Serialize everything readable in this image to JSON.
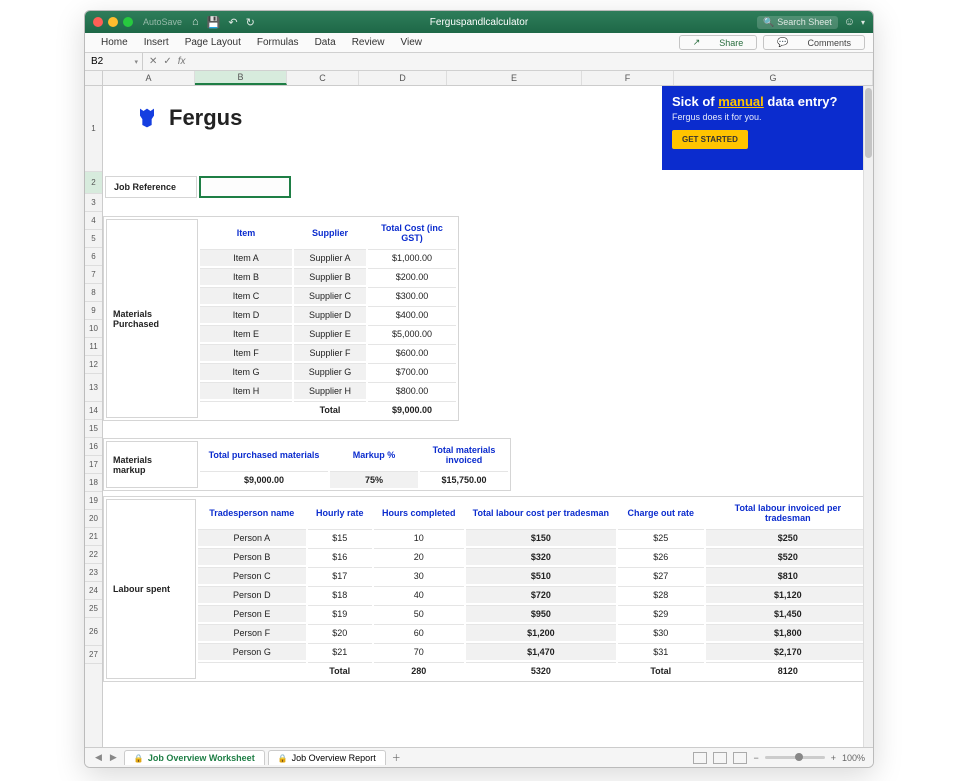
{
  "titlebar": {
    "autosave": "AutoSave",
    "title": "Ferguspandlcalculator",
    "search_placeholder": "Search Sheet"
  },
  "ribbon": {
    "tabs": [
      "Home",
      "Insert",
      "Page Layout",
      "Formulas",
      "Data",
      "Review",
      "View"
    ],
    "share": "Share",
    "comments": "Comments"
  },
  "formula": {
    "cell": "B2",
    "fx": "fx"
  },
  "columns": [
    "A",
    "B",
    "C",
    "D",
    "E",
    "F",
    "G"
  ],
  "logo": "Fergus",
  "banner": {
    "pre": "Sick of ",
    "mid": "manual",
    "post": " data entry?",
    "sub": "Fergus does it for you.",
    "cta": "GET STARTED"
  },
  "jobref": {
    "label": "Job Reference",
    "value": ""
  },
  "materials": {
    "section": "Materials Purchased",
    "headers": [
      "Item",
      "Supplier",
      "Total Cost (inc GST)"
    ],
    "rows": [
      [
        "Item A",
        "Supplier A",
        "$1,000.00"
      ],
      [
        "Item B",
        "Supplier B",
        "$200.00"
      ],
      [
        "Item C",
        "Supplier C",
        "$300.00"
      ],
      [
        "Item D",
        "Supplier D",
        "$400.00"
      ],
      [
        "Item E",
        "Supplier E",
        "$5,000.00"
      ],
      [
        "Item F",
        "Supplier F",
        "$600.00"
      ],
      [
        "Item G",
        "Supplier G",
        "$700.00"
      ],
      [
        "Item H",
        "Supplier H",
        "$800.00"
      ]
    ],
    "total_label": "Total",
    "total": "$9,000.00"
  },
  "markup": {
    "section": "Materials markup",
    "headers": [
      "Total purchased materials",
      "Markup %",
      "Total materials invoiced"
    ],
    "row": [
      "$9,000.00",
      "75%",
      "$15,750.00"
    ]
  },
  "labour": {
    "section": "Labour spent",
    "headers": [
      "Tradesperson name",
      "Hourly rate",
      "Hours completed",
      "Total labour cost per tradesman",
      "Charge out rate",
      "Total labour invoiced per tradesman"
    ],
    "rows": [
      [
        "Person A",
        "$15",
        "10",
        "$150",
        "$25",
        "$250"
      ],
      [
        "Person B",
        "$16",
        "20",
        "$320",
        "$26",
        "$520"
      ],
      [
        "Person C",
        "$17",
        "30",
        "$510",
        "$27",
        "$810"
      ],
      [
        "Person D",
        "$18",
        "40",
        "$720",
        "$28",
        "$1,120"
      ],
      [
        "Person E",
        "$19",
        "50",
        "$950",
        "$29",
        "$1,450"
      ],
      [
        "Person F",
        "$20",
        "60",
        "$1,200",
        "$30",
        "$1,800"
      ],
      [
        "Person G",
        "$21",
        "70",
        "$1,470",
        "$31",
        "$2,170"
      ]
    ],
    "total_label": "Total",
    "hours_total": "280",
    "cost_total": "5320",
    "invoiced_total_label": "Total",
    "invoiced_total": "8120"
  },
  "sheets": {
    "tab1": "Job Overview Worksheet",
    "tab2": "Job Overview Report"
  },
  "status": {
    "zoom": "100%"
  }
}
